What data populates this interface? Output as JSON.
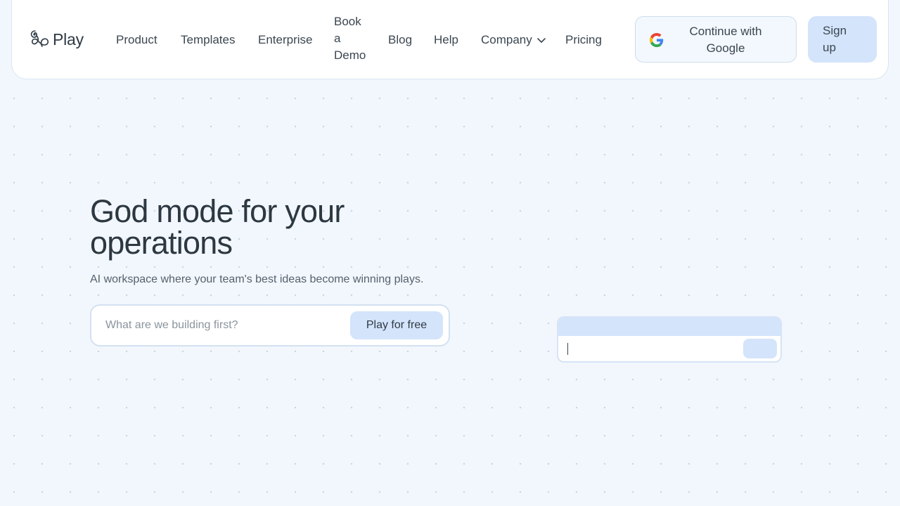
{
  "logo": {
    "text": "Play",
    "icon": "play-logo-icon"
  },
  "nav": {
    "product": "Product",
    "templates": "Templates",
    "enterprise": "Enterprise",
    "book_demo": "Book a Demo",
    "blog": "Blog",
    "help": "Help",
    "company": "Company",
    "pricing": "Pricing"
  },
  "auth": {
    "google_label": "Continue with Google",
    "signup_label": "Sign up"
  },
  "hero": {
    "title": "God mode for your operations",
    "subtitle": "AI workspace where your team's best ideas become winning plays.",
    "input_placeholder": "What are we building first?",
    "cta_label": "Play for free"
  },
  "colors": {
    "background": "#f2f7fd",
    "accent": "#d4e4fb",
    "text": "#2f3a44"
  }
}
